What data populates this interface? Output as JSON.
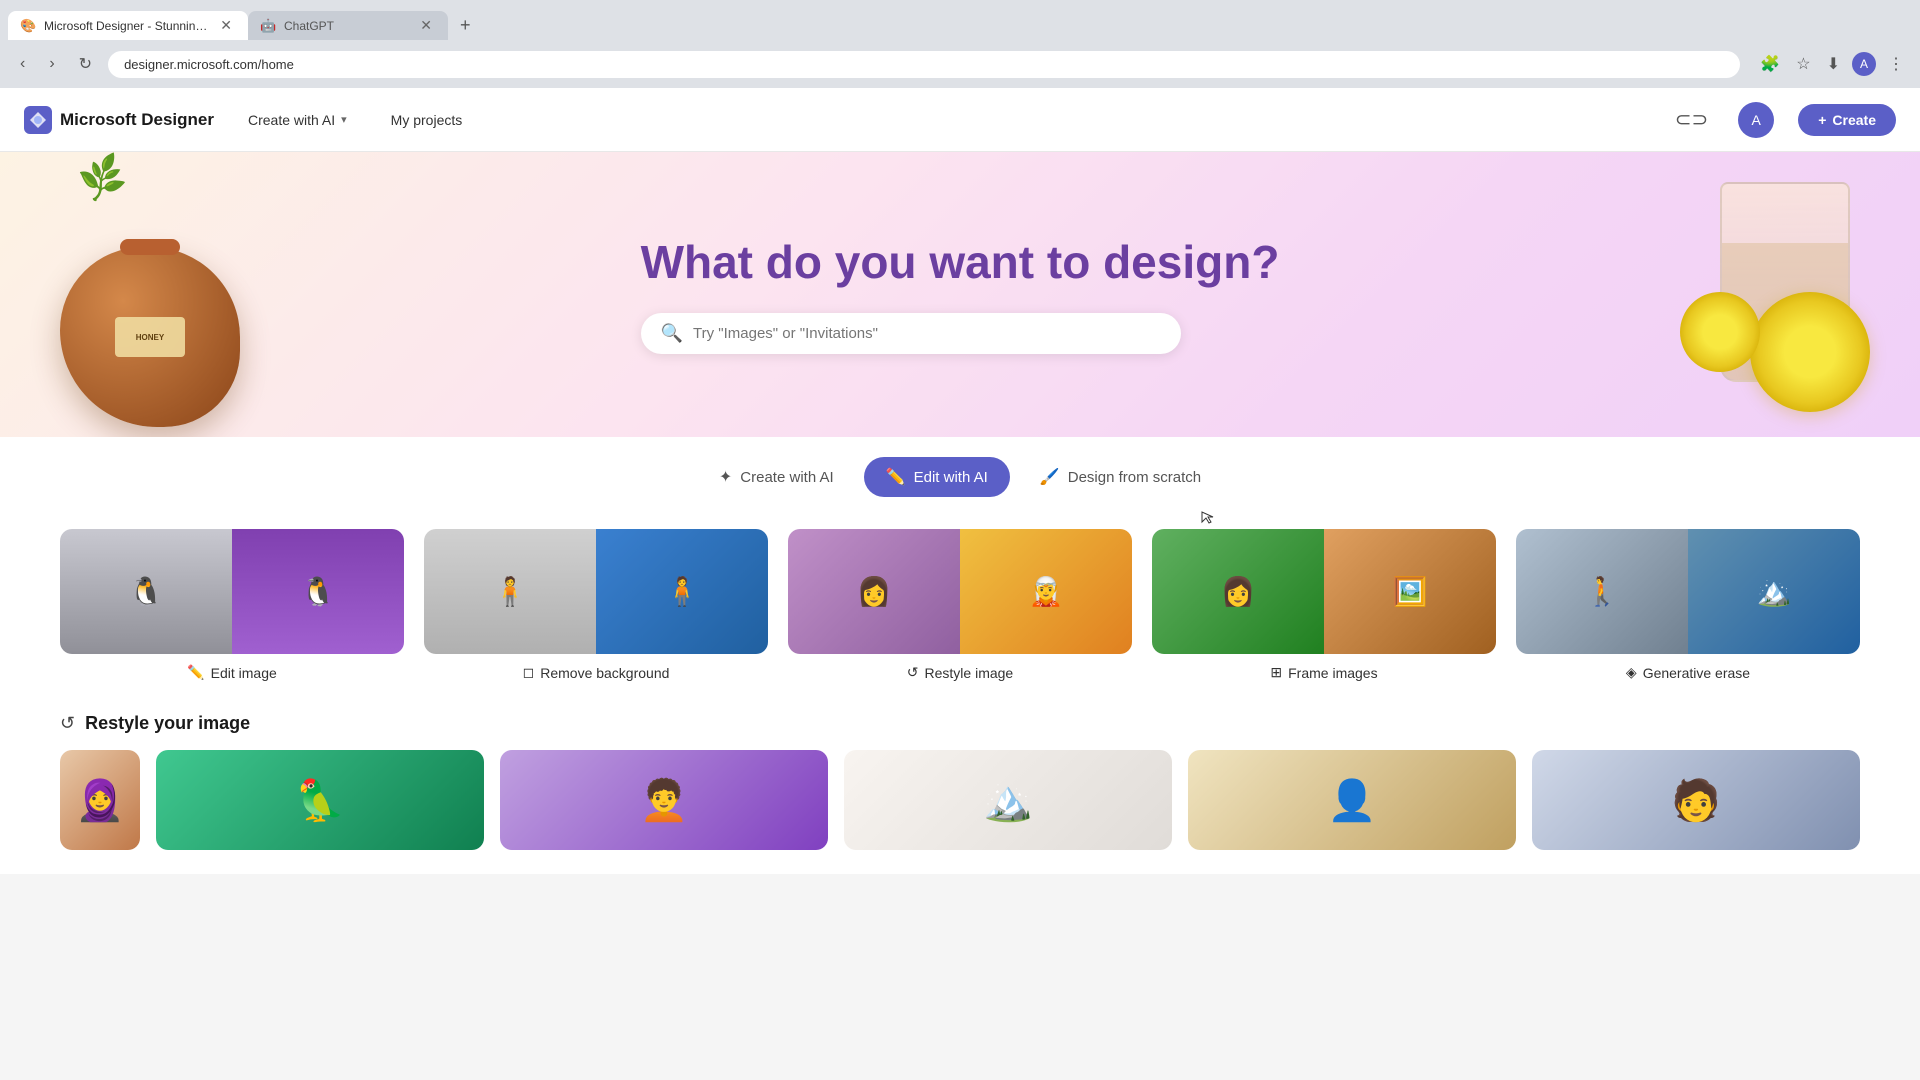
{
  "browser": {
    "tabs": [
      {
        "id": "tab-designer",
        "title": "Microsoft Designer - Stunning...",
        "url": "designer.microsoft.com/home",
        "active": true,
        "favicon": "🎨"
      },
      {
        "id": "tab-chatgpt",
        "title": "ChatGPT",
        "active": false,
        "favicon": "🤖"
      }
    ],
    "address": "designer.microsoft.com/home",
    "new_tab_label": "+"
  },
  "navbar": {
    "brand_name": "Microsoft Designer",
    "nav_create_ai": "Create with AI",
    "nav_my_projects": "My projects",
    "create_button": "+ Create",
    "icons": [
      "share-icon",
      "profile-icon"
    ]
  },
  "hero": {
    "title": "What do you want to design?",
    "search_placeholder": "Try \"Images\" or \"Invitations\""
  },
  "mode_tabs": [
    {
      "id": "create-ai",
      "label": "Create with AI",
      "icon": "✦",
      "active": false
    },
    {
      "id": "edit-ai",
      "label": "Edit with AI",
      "icon": "✏️",
      "active": true
    },
    {
      "id": "design-scratch",
      "label": "Design from scratch",
      "icon": "🖌️",
      "active": false
    }
  ],
  "edit_cards": [
    {
      "id": "edit-image",
      "label": "Edit image",
      "icon": "✏️"
    },
    {
      "id": "remove-bg",
      "label": "Remove background",
      "icon": "◻"
    },
    {
      "id": "restyle-image",
      "label": "Restyle image",
      "icon": "↺"
    },
    {
      "id": "frame-images",
      "label": "Frame images",
      "icon": "⊞"
    },
    {
      "id": "generative-erase",
      "label": "Generative erase",
      "icon": "◈"
    }
  ],
  "restyle_section": {
    "title": "Restyle your image",
    "icon": "↺"
  },
  "colors": {
    "primary": "#5b5fc7",
    "hero_text": "#6b3fa0",
    "bg_gradient_start": "#fdf3e3",
    "bg_gradient_end": "#f0d0f8"
  }
}
